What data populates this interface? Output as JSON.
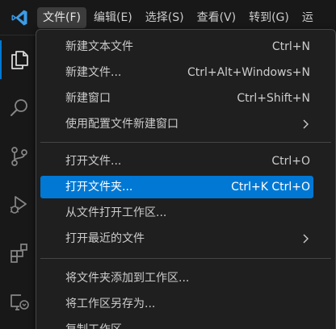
{
  "colors": {
    "accent": "#0078d4",
    "logo_blue": "#3b9de8",
    "menu_bg": "#1f1f1f",
    "highlight": "#0078d4",
    "text": "#cccccc"
  },
  "titlebar": {
    "logo_icon": "vscode-logo-icon",
    "menus": [
      {
        "label": "文件(F)"
      },
      {
        "label": "编辑(E)"
      },
      {
        "label": "选择(S)"
      },
      {
        "label": "查看(V)"
      },
      {
        "label": "转到(G)"
      },
      {
        "label": "运"
      }
    ]
  },
  "activity_bar": {
    "items": [
      {
        "icon": "explorer-icon"
      },
      {
        "icon": "search-icon"
      },
      {
        "icon": "source-control-icon"
      },
      {
        "icon": "run-debug-icon"
      },
      {
        "icon": "extensions-icon"
      },
      {
        "icon": "remote-explorer-icon"
      }
    ]
  },
  "file_menu": {
    "groups": [
      [
        {
          "label": "新建文本文件",
          "shortcut": "Ctrl+N"
        },
        {
          "label": "新建文件...",
          "shortcut": "Ctrl+Alt+Windows+N"
        },
        {
          "label": "新建窗口",
          "shortcut": "Ctrl+Shift+N"
        },
        {
          "label": "使用配置文件新建窗口",
          "submenu_icon": "chevron-right-icon"
        }
      ],
      [
        {
          "label": "打开文件...",
          "shortcut": "Ctrl+O"
        },
        {
          "label": "打开文件夹...",
          "shortcut": "Ctrl+K Ctrl+O",
          "highlighted": true
        },
        {
          "label": "从文件打开工作区..."
        },
        {
          "label": "打开最近的文件",
          "submenu_icon": "chevron-right-icon"
        }
      ],
      [
        {
          "label": "将文件夹添加到工作区..."
        },
        {
          "label": "将工作区另存为..."
        },
        {
          "label": "复制工作区"
        }
      ]
    ]
  }
}
